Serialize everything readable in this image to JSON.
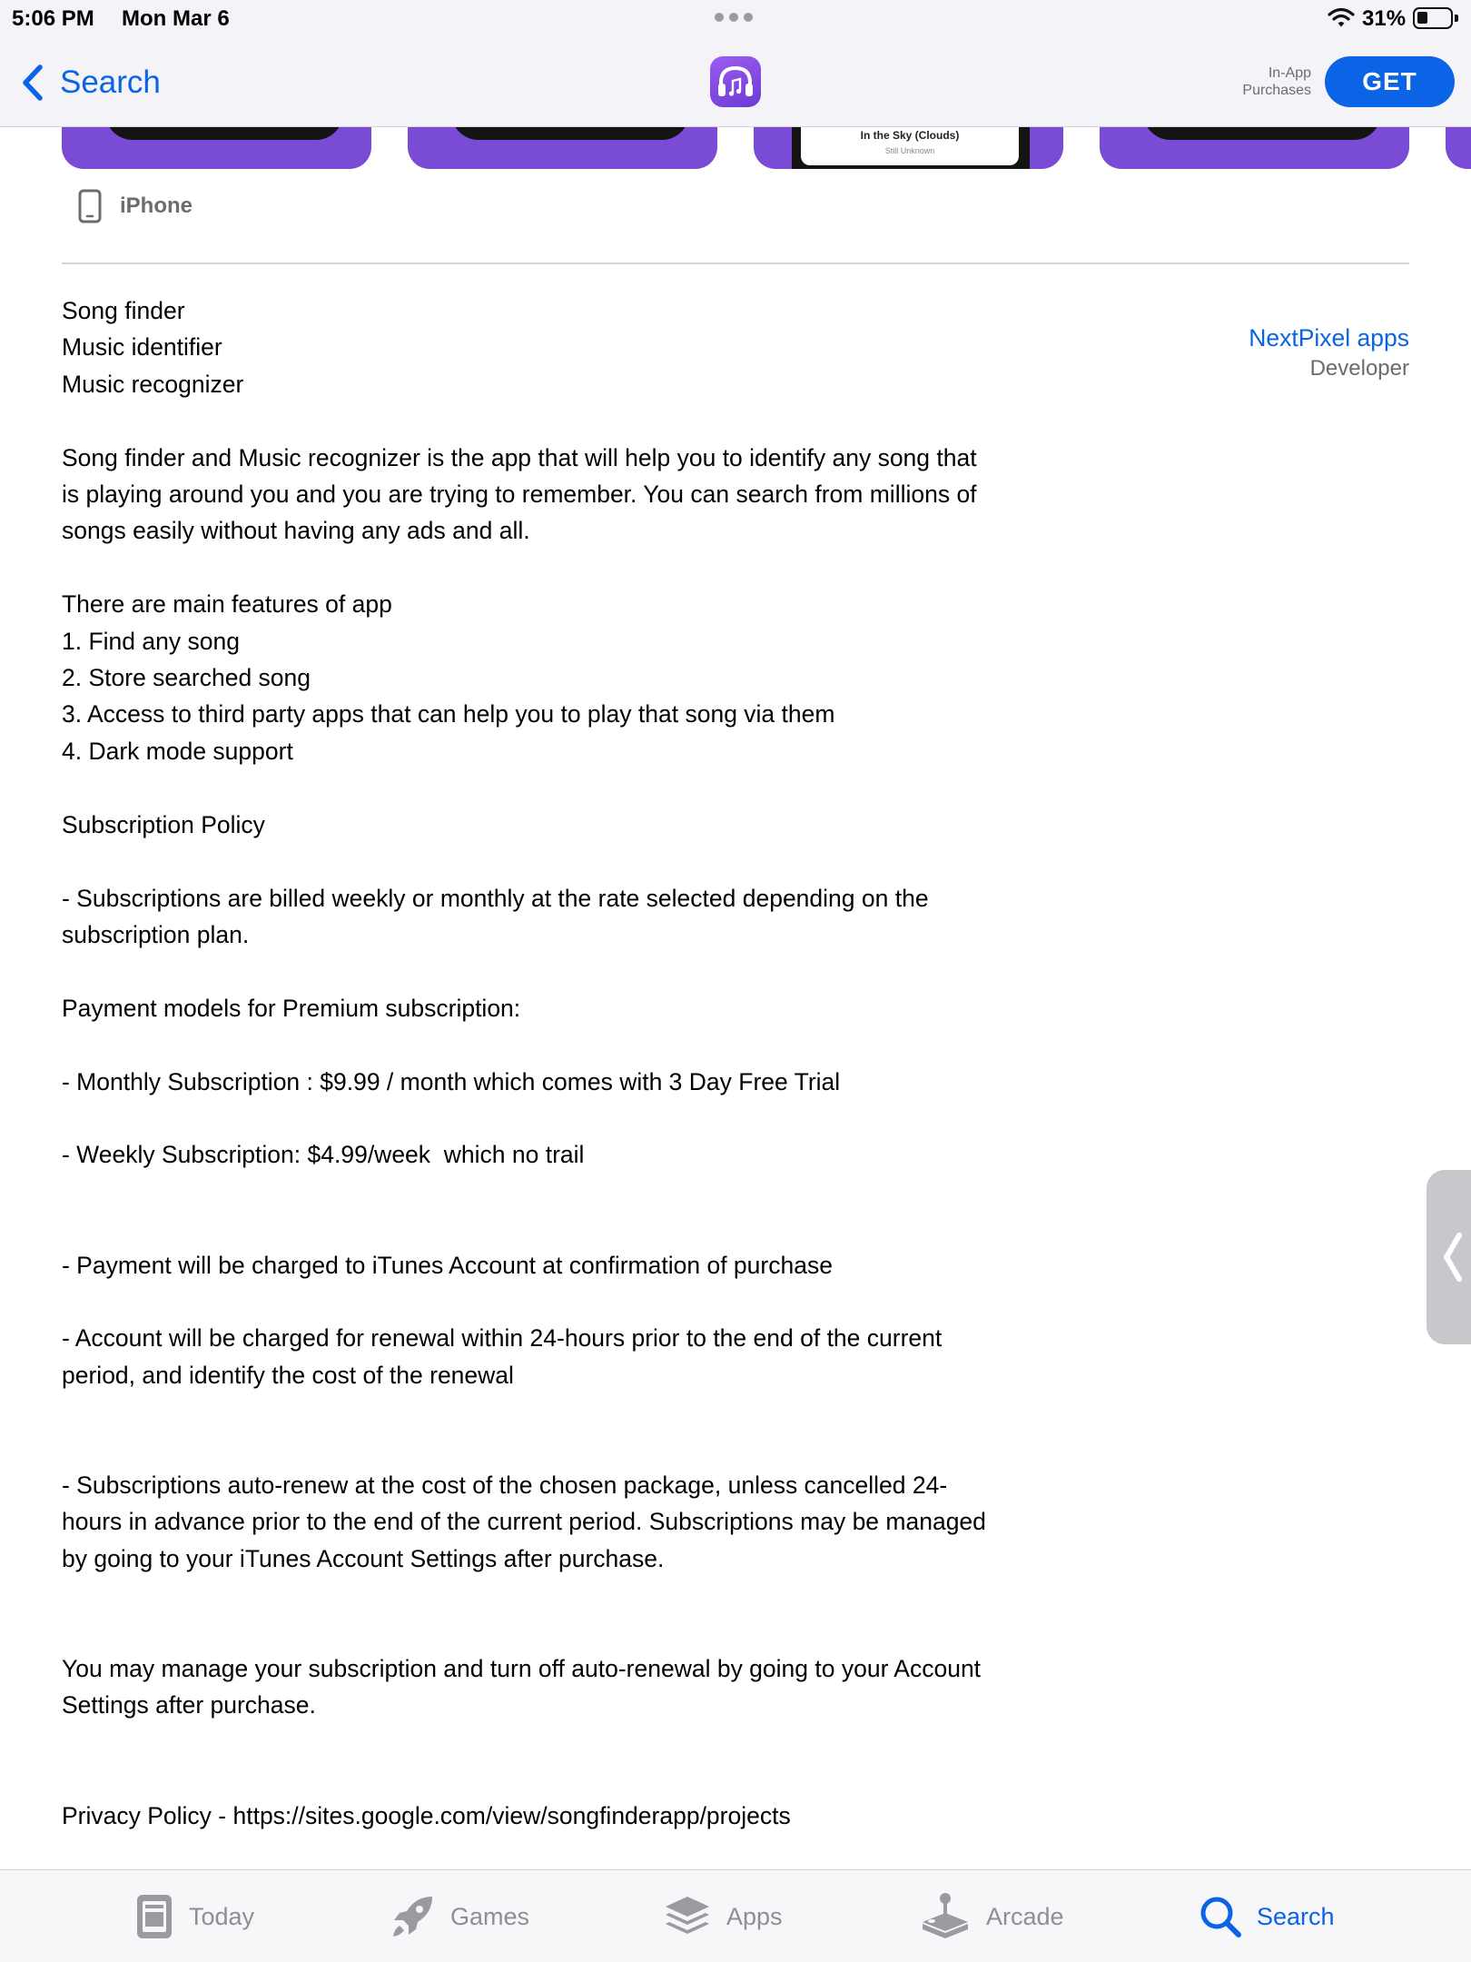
{
  "status_bar": {
    "time": "5:06 PM",
    "date": "Mon Mar 6",
    "battery_percent": "31%",
    "battery_level": 0.31
  },
  "nav": {
    "back_label": "Search",
    "in_app_label": "In-App\nPurchases",
    "get_label": "GET"
  },
  "screenshots": {
    "visible_song_title": "In the Sky (Clouds)",
    "visible_song_artist": "Still Unknown"
  },
  "device": {
    "label": "iPhone"
  },
  "description": {
    "paragraphs": [
      "Song finder\nMusic identifier\nMusic recognizer",
      "\nSong finder and Music recognizer is the app that will help you to identify any song that\nis playing around you and you are trying to remember. You can search from millions of\nsongs easily without having any ads and all.",
      "\nThere are main features of app\n1. Find any song\n2. Store searched song\n3. Access to third party apps that can help you to play that song via them\n4. Dark mode support",
      "\nSubscription Policy",
      "\n- Subscriptions are billed weekly or monthly at the rate selected depending on the\nsubscription plan.",
      "\nPayment models for Premium subscription:",
      "\n- Monthly Subscription : $9.99 / month which comes with 3 Day Free Trial",
      "\n- Weekly Subscription: $4.99/week  which no trail",
      "\n\n- Payment will be charged to iTunes Account at confirmation of purchase",
      "\n- Account will be charged for renewal within 24-hours prior to the end of the current\nperiod, and identify the cost of the renewal",
      "\n\n- Subscriptions auto-renew at the cost of the chosen package, unless cancelled 24-\nhours in advance prior to the end of the current period. Subscriptions may be managed\nby going to your iTunes Account Settings after purchase.",
      "\n\nYou may manage your subscription and turn off auto-renewal by going to your Account\nSettings after purchase.",
      "\n\nPrivacy Policy - https://sites.google.com/view/songfinderapp/projects"
    ]
  },
  "developer": {
    "name": "NextPixel apps",
    "role": "Developer"
  },
  "tabbar": {
    "today": "Today",
    "games": "Games",
    "apps": "Apps",
    "arcade": "Arcade",
    "search": "Search",
    "active": "search"
  },
  "colors": {
    "accent": "#0b63e5",
    "screenshot_bg": "#7a4bd4",
    "bar_bg": "#f4f3f8"
  }
}
